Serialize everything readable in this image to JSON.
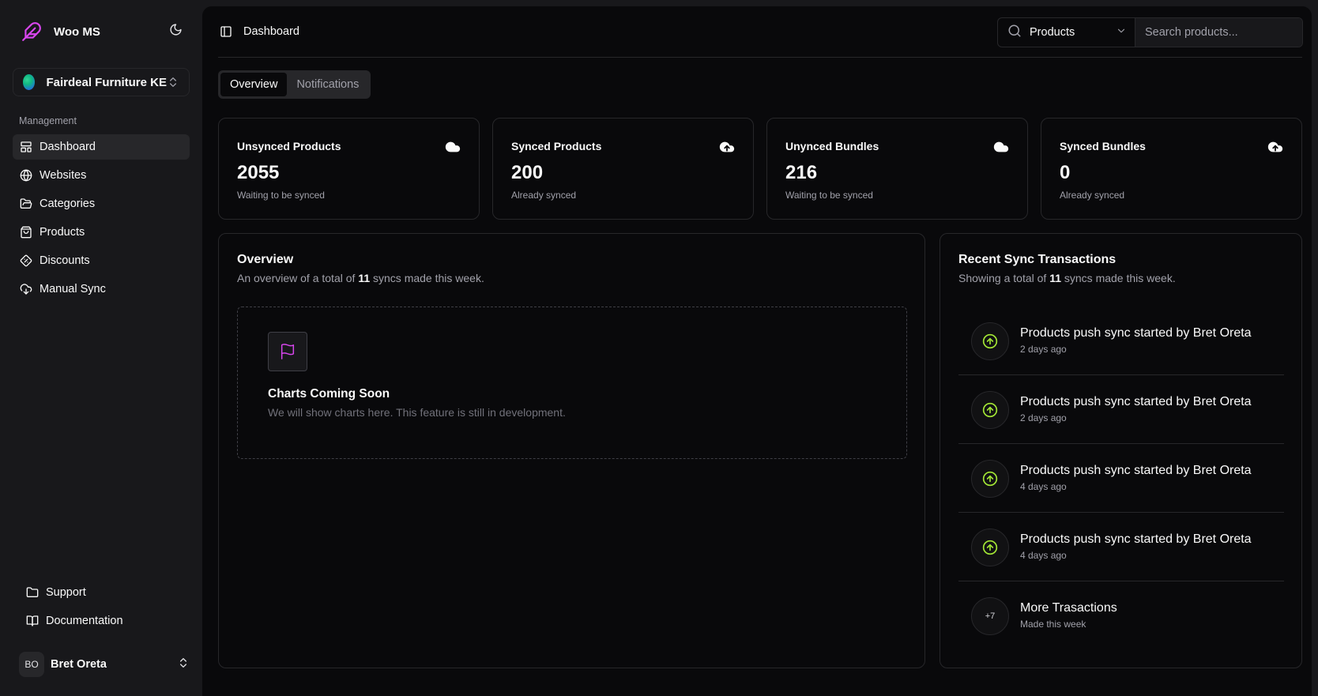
{
  "app": {
    "name": "Woo MS",
    "accent": "#d946ef",
    "success": "#a3e635"
  },
  "store": {
    "name": "Fairdeal Furniture KE"
  },
  "sidebar": {
    "group_label": "Management",
    "items": [
      {
        "label": "Dashboard",
        "icon": "layout-dashboard-icon",
        "active": true
      },
      {
        "label": "Websites",
        "icon": "globe-icon"
      },
      {
        "label": "Categories",
        "icon": "folder-open-icon"
      },
      {
        "label": "Products",
        "icon": "shopping-bag-icon"
      },
      {
        "label": "Discounts",
        "icon": "tag-icon"
      },
      {
        "label": "Manual Sync",
        "icon": "cloud-sync-icon"
      }
    ],
    "footer": [
      {
        "label": "Support",
        "icon": "folder-icon"
      },
      {
        "label": "Documentation",
        "icon": "book-open-icon"
      }
    ]
  },
  "user": {
    "initials": "BO",
    "name": "Bret Oreta"
  },
  "header": {
    "breadcrumb": "Dashboard",
    "search_scope": "Products",
    "search_placeholder": "Search products..."
  },
  "tabs": [
    {
      "label": "Overview",
      "active": true
    },
    {
      "label": "Notifications",
      "active": false
    }
  ],
  "stats": [
    {
      "title": "Unsynced Products",
      "value": "2055",
      "sub": "Waiting to be synced",
      "icon": "cloud-icon"
    },
    {
      "title": "Synced Products",
      "value": "200",
      "sub": "Already synced",
      "icon": "cloud-upload-icon"
    },
    {
      "title": "Unynced Bundles",
      "value": "216",
      "sub": "Waiting to be synced",
      "icon": "cloud-icon"
    },
    {
      "title": "Synced Bundles",
      "value": "0",
      "sub": "Already synced",
      "icon": "cloud-upload-icon"
    }
  ],
  "overview": {
    "title": "Overview",
    "desc_prefix": "An overview of a total of ",
    "desc_count": "11",
    "desc_suffix": " syncs made this week.",
    "placeholder_title": "Charts Coming Soon",
    "placeholder_desc": "We will show charts here. This feature is still in development."
  },
  "recent": {
    "title": "Recent Sync Transactions",
    "desc_prefix": "Showing a total of ",
    "desc_count": "11",
    "desc_suffix": " syncs made this week.",
    "items": [
      {
        "title": "Products push sync started by Bret Oreta",
        "time": "2 days ago"
      },
      {
        "title": "Products push sync started by Bret Oreta",
        "time": "2 days ago"
      },
      {
        "title": "Products push sync started by Bret Oreta",
        "time": "4 days ago"
      },
      {
        "title": "Products push sync started by Bret Oreta",
        "time": "4 days ago"
      }
    ],
    "more": {
      "count": "+7",
      "title": "More Trasactions",
      "sub": "Made this week"
    }
  }
}
